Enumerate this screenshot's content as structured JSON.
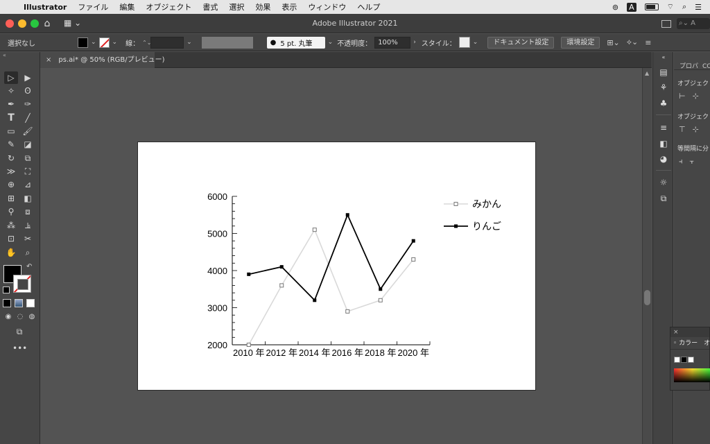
{
  "menubar": {
    "app": "Illustrator",
    "items": [
      "ファイル",
      "編集",
      "オブジェクト",
      "書式",
      "選択",
      "効果",
      "表示",
      "ウィンドウ",
      "ヘルプ"
    ],
    "status_a": "A"
  },
  "titlebar": {
    "title": "Adobe Illustrator 2021"
  },
  "controlbar": {
    "selection": "選択なし",
    "stroke_label": "線：",
    "brush": "5 pt. 丸筆",
    "opacity_label": "不透明度：",
    "opacity_value": "100%",
    "style_label": "スタイル：",
    "doc_settings": "ドキュメント設定",
    "preferences": "環境設定"
  },
  "tab": {
    "title": "ps.ai* @ 50% (RGB/プレビュー)",
    "close": "×"
  },
  "right_panel": {
    "tabs": [
      "プロパ",
      "CC"
    ],
    "heading1": "オブジェク",
    "heading2": "オブジェク",
    "heading3": "等間隔に分"
  },
  "color_panel": {
    "close": "×",
    "tab": "◦ カラー　オ"
  },
  "colors": {
    "chart_line_1": "#d9d9d9",
    "chart_line_2": "#000000",
    "canvas": "#535353",
    "artboard": "#ffffff"
  },
  "chart_data": {
    "type": "line",
    "x": [
      "2010 年",
      "2012 年",
      "2014 年",
      "2016 年",
      "2018 年",
      "2020 年"
    ],
    "ylim": [
      2000,
      6000
    ],
    "yticks": [
      "2000",
      "3000",
      "4000",
      "5000",
      "6000"
    ],
    "series": [
      {
        "name": "みかん",
        "values": [
          2000,
          3600,
          5100,
          2900,
          3200,
          4300
        ],
        "color": "#d9d9d9"
      },
      {
        "name": "りんご",
        "values": [
          3900,
          4100,
          3200,
          5500,
          3500,
          4800
        ],
        "color": "#000000"
      }
    ],
    "legend": "top-right"
  }
}
